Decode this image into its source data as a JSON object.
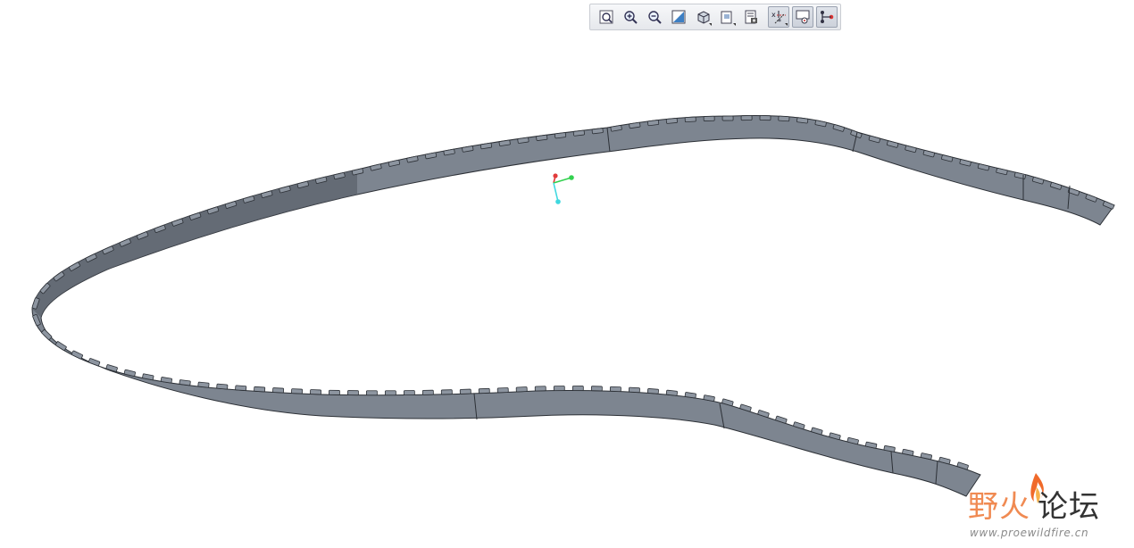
{
  "toolbar": {
    "buttons": [
      {
        "name": "refit-button",
        "icon": "zoom-fit-icon",
        "active": false,
        "caret": false
      },
      {
        "name": "zoom-in-button",
        "icon": "zoom-in-icon",
        "active": false,
        "caret": false
      },
      {
        "name": "zoom-out-button",
        "icon": "zoom-out-icon",
        "active": false,
        "caret": false
      },
      {
        "name": "repaint-button",
        "icon": "repaint-icon",
        "active": false,
        "caret": false
      },
      {
        "name": "display-style-button",
        "icon": "shaded-cube-icon",
        "active": false,
        "caret": true
      },
      {
        "name": "saved-views-button",
        "icon": "saved-views-icon",
        "active": false,
        "caret": true
      },
      {
        "name": "view-manager-button",
        "icon": "view-manager-icon",
        "active": false,
        "caret": false
      },
      {
        "name": "datum-display-button",
        "icon": "datum-display-icon",
        "active": true,
        "caret": true
      },
      {
        "name": "spin-center-button",
        "icon": "spin-center-icon",
        "active": true,
        "caret": false
      },
      {
        "name": "annotation-display-button",
        "icon": "annotation-display-icon",
        "active": true,
        "caret": false
      }
    ]
  },
  "model": {
    "belt_top_color": "#7d8590",
    "belt_side_color": "#5a6069",
    "edge_color": "#2c3036"
  },
  "csys": {
    "x_color": "#e23b3b",
    "y_color": "#33d14f",
    "z_color": "#3fd8df"
  },
  "watermark": {
    "logo_left": "野火",
    "logo_right": "论坛",
    "url": "www.proewildfire.cn"
  }
}
